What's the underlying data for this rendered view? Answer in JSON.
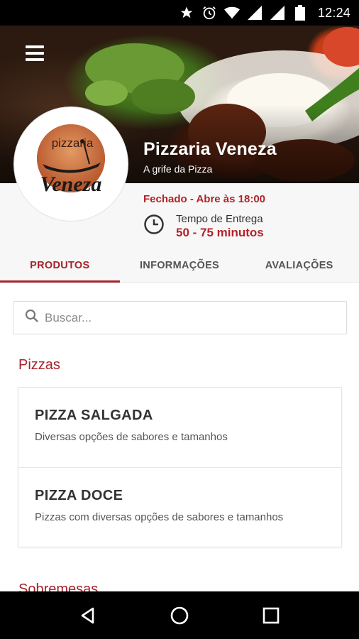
{
  "status_bar": {
    "time": "12:24",
    "icons": [
      "star-icon",
      "alarm-icon",
      "wifi-icon",
      "signal-icon",
      "signal-icon",
      "battery-icon"
    ]
  },
  "store": {
    "name": "Pizzaria Veneza",
    "tagline": "A grife da Pizza",
    "logo_text_top": "pizzaria",
    "logo_text_main": "Veneza",
    "status": "Fechado - Abre às 18:00",
    "delivery_label": "Tempo de Entrega",
    "delivery_time": "50 - 75 minutos"
  },
  "tabs": [
    {
      "label": "PRODUTOS",
      "active": true
    },
    {
      "label": "INFORMAÇÕES",
      "active": false
    },
    {
      "label": "AVALIAÇÕES",
      "active": false
    }
  ],
  "search": {
    "placeholder": "Buscar..."
  },
  "sections": [
    {
      "title": "Pizzas",
      "items": [
        {
          "title": "PIZZA SALGADA",
          "description": "Diversas opções de sabores e tamanhos"
        },
        {
          "title": "PIZZA DOCE",
          "description": "Pizzas com diversas opções de sabores e tamanhos"
        }
      ]
    },
    {
      "title": "Sobremesas",
      "items": []
    }
  ],
  "colors": {
    "accent": "#a3232a",
    "status_red": "#b3232a",
    "background": "#f7f7f7"
  },
  "nav_bar": [
    "back-icon",
    "home-icon",
    "recents-icon"
  ]
}
